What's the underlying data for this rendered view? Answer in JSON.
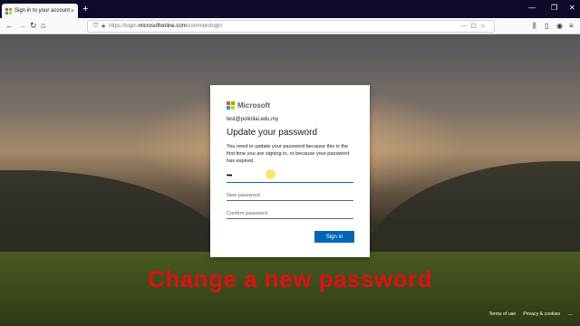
{
  "browser": {
    "tab_title": "Sign in to your account",
    "tab_close": "×",
    "new_tab": "+",
    "window_controls": [
      "—",
      "❐",
      "✕"
    ],
    "url_prefix": "https://login.",
    "url_domain": "microsoftonline.com",
    "url_path": "/common/login"
  },
  "card": {
    "brand": "Microsoft",
    "account": "test@polinilai.edu.my",
    "heading": "Update your password",
    "description": "You need to update your password because this is the first time you are signing in, or because your password has expired.",
    "current_password_value": "•••",
    "new_password_placeholder": "New password",
    "confirm_password_placeholder": "Confirm password",
    "signin_label": "Sign in"
  },
  "overlay_caption": "Change a new password",
  "footer": {
    "terms": "Terms of use",
    "privacy": "Privacy & cookies",
    "more": "..."
  },
  "colors": {
    "accent": "#0067b8",
    "caption": "#e01010",
    "ms_red": "#f25022",
    "ms_green": "#7fba00",
    "ms_blue": "#00a4ef",
    "ms_yellow": "#ffb900"
  }
}
